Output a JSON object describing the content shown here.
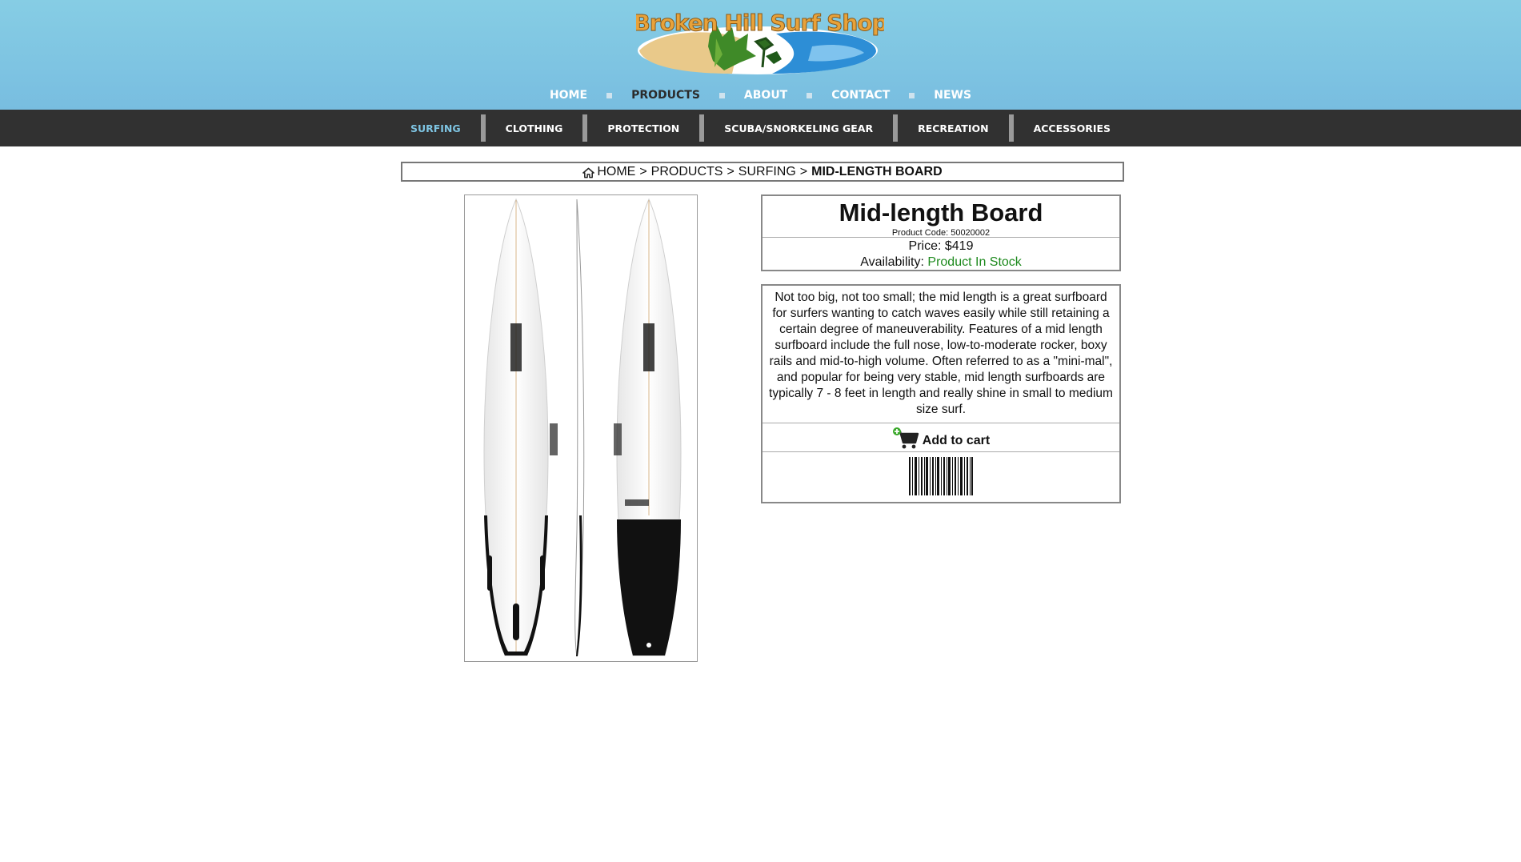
{
  "header": {
    "logo_text": "Broken Hill Surf Shop",
    "nav": [
      "HOME",
      "PRODUCTS",
      "ABOUT",
      "CONTACT",
      "NEWS"
    ],
    "active_nav": "PRODUCTS"
  },
  "subnav": {
    "items": [
      "SURFING",
      "CLOTHING",
      "PROTECTION",
      "SCUBA/SNORKELING GEAR",
      "RECREATION",
      "ACCESSORIES"
    ],
    "active": "SURFING"
  },
  "breadcrumb": {
    "home": "HOME",
    "sep": ">",
    "products": "PRODUCTS",
    "category": "SURFING",
    "current": "MID-LENGTH BOARD"
  },
  "product": {
    "title": "Mid-length Board",
    "code_label": "Product Code: 50020002",
    "price_label": "Price: $419",
    "availability_label": "Availability:",
    "availability_value": "Product In Stock",
    "description": "Not too big, not too small; the mid length is a great surfboard for surfers wanting to catch waves easily while still retaining a certain degree of maneuverability. Features of a mid length surfboard include the full nose, low-to-moderate rocker, boxy rails and mid-to-high volume. Often referred to as a \"mini-mal\", and popular for being very stable, mid length surfboards are typically 7 - 8 feet in length and really shine in small to medium size surf.",
    "add_to_cart": "Add to cart"
  },
  "colors": {
    "header_blue": "#7ec4e2",
    "subnav_bg": "#313131",
    "active_sub": "#7ec4e2",
    "in_stock": "#1e8a1e"
  }
}
